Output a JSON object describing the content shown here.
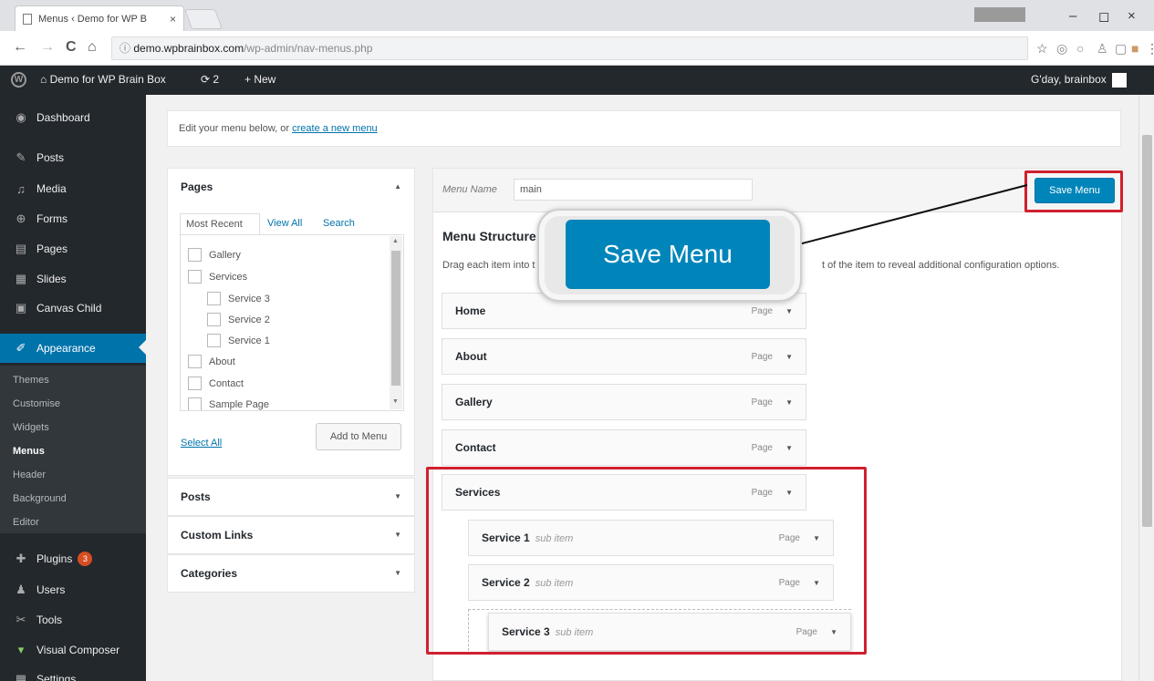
{
  "browser": {
    "tab_title": "Menus ‹ Demo for WP B",
    "tab_close": "×",
    "user_badge": "",
    "window_controls": {
      "minimize": "–",
      "maximize": "◻",
      "close": "×"
    },
    "nav": {
      "back": "←",
      "forward": "→",
      "reload": "C",
      "home": "⌂"
    },
    "url_host": "demo.wpbrainbox.com",
    "url_path": "/wp-admin/nav-menus.php",
    "extension_icons": [
      "star-icon",
      "camera-icon",
      "magnifier-icon",
      "puzzle-icon",
      "copy-icon",
      "extension-icon",
      "menu-dots-icon"
    ]
  },
  "adminbar": {
    "site_name": "Demo for WP Brain Box",
    "updates_count": "2",
    "new_label": "New",
    "greeting": "G'day, brainbox"
  },
  "sidebar": {
    "items": [
      {
        "label": "Dashboard",
        "icon": "dashboard-icon"
      },
      {
        "label": "Posts",
        "icon": "pin-icon"
      },
      {
        "label": "Media",
        "icon": "media-icon"
      },
      {
        "label": "Forms",
        "icon": "forms-icon"
      },
      {
        "label": "Pages",
        "icon": "pages-icon"
      },
      {
        "label": "Slides",
        "icon": "slides-icon"
      },
      {
        "label": "Canvas Child",
        "icon": "canvas-icon"
      },
      {
        "label": "Appearance",
        "icon": "brush-icon"
      }
    ],
    "submenu": [
      "Themes",
      "Customise",
      "Widgets",
      "Menus",
      "Header",
      "Background",
      "Editor"
    ],
    "items_bottom": [
      {
        "label": "Plugins",
        "icon": "plugin-icon",
        "badge": "3"
      },
      {
        "label": "Users",
        "icon": "users-icon"
      },
      {
        "label": "Tools",
        "icon": "tools-icon"
      },
      {
        "label": "Visual Composer",
        "icon": "vc-icon"
      },
      {
        "label": "Settings",
        "icon": "settings-icon"
      }
    ]
  },
  "notice": {
    "text": "Edit your menu below, or ",
    "link": "create a new menu"
  },
  "pages_box": {
    "title": "Pages",
    "tabs": [
      "Most Recent",
      "View All",
      "Search"
    ],
    "items": [
      "Gallery",
      "Services",
      "Service 3",
      "Service 2",
      "Service 1",
      "About",
      "Contact",
      "Sample Page"
    ],
    "select_all": "Select All",
    "add_button": "Add to Menu"
  },
  "accordions": [
    "Posts",
    "Custom Links",
    "Categories"
  ],
  "menu_editor": {
    "name_label": "Menu Name",
    "name_value": "main",
    "save_button": "Save Menu",
    "structure_title": "Menu Structure",
    "desc_left": "Drag each item into t",
    "desc_right": "t of the item to reveal additional configuration options.",
    "items": [
      {
        "label": "Home",
        "sub": "",
        "type": "Page"
      },
      {
        "label": "About",
        "sub": "",
        "type": "Page"
      },
      {
        "label": "Gallery",
        "sub": "",
        "type": "Page"
      },
      {
        "label": "Contact",
        "sub": "",
        "type": "Page"
      },
      {
        "label": "Services",
        "sub": "",
        "type": "Page"
      },
      {
        "label": "Service 1",
        "sub": "sub item",
        "type": "Page"
      },
      {
        "label": "Service 2",
        "sub": "sub item",
        "type": "Page"
      },
      {
        "label": "Service 3",
        "sub": "sub item",
        "type": "Page"
      }
    ]
  },
  "callout": {
    "label": "Save Menu"
  },
  "colors": {
    "wp_blue": "#0085ba",
    "admin_dark": "#23282d",
    "highlight_red": "#d0202f"
  }
}
